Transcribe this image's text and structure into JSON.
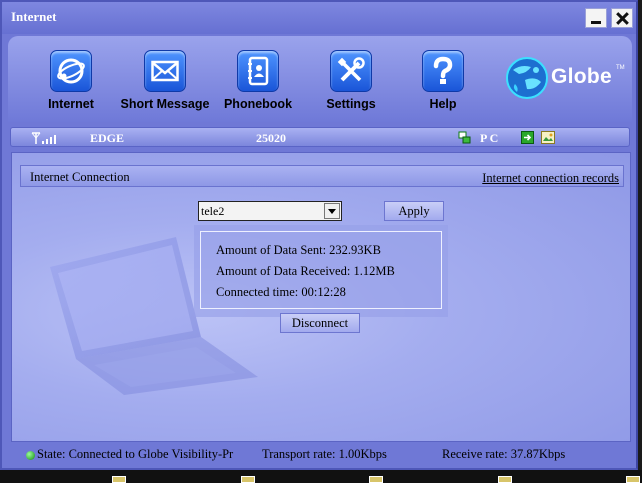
{
  "window": {
    "title": "Internet"
  },
  "toolbar": {
    "items": [
      {
        "label": "Internet",
        "icon": "internet-globe-icon"
      },
      {
        "label": "Short Message",
        "icon": "envelope-icon"
      },
      {
        "label": "Phonebook",
        "icon": "phonebook-icon"
      },
      {
        "label": "Settings",
        "icon": "tools-icon"
      },
      {
        "label": "Help",
        "icon": "question-icon"
      }
    ],
    "brand": "Globe",
    "brand_tm": "TM"
  },
  "status_strip": {
    "network_type": "EDGE",
    "operator_code": "25020",
    "mode": "P C"
  },
  "connection": {
    "section_title": "Internet Connection",
    "records_link": "Internet connection records",
    "profile_selected": "tele2",
    "apply_label": "Apply",
    "data_sent": "Amount of Data Sent: 232.93KB",
    "data_received": "Amount of Data Received: 1.12MB",
    "connected_time": "Connected time: 00:12:28",
    "disconnect_label": "Disconnect"
  },
  "footer": {
    "state": "State: Connected to Globe Visibility-Pr",
    "transport_rate": "Transport rate: 1.00Kbps",
    "receive_rate": "Receive rate: 37.87Kbps"
  },
  "colors": {
    "window_bg": "#6f78d6",
    "panel_bg": "#a4adef",
    "icon_blue": "#1a55d8"
  }
}
